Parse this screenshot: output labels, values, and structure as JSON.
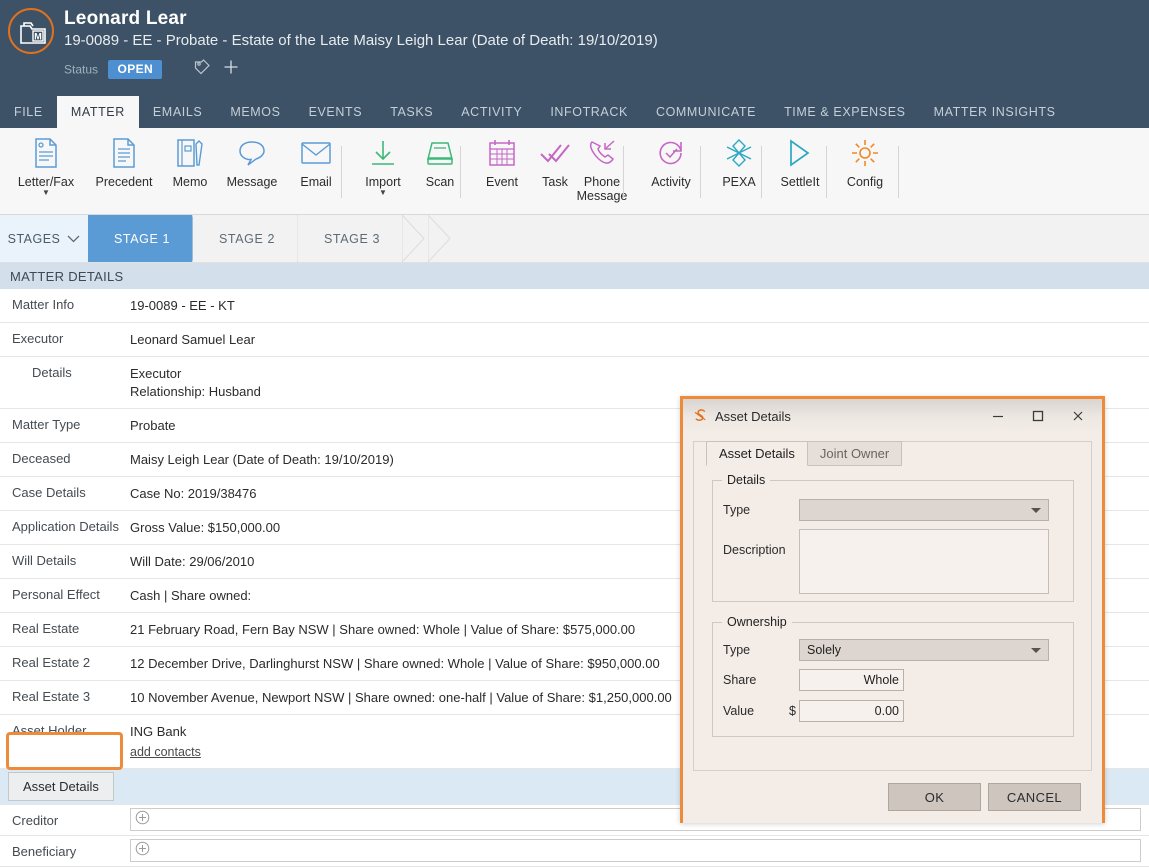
{
  "header": {
    "client_name": "Leonard Lear",
    "matter_line": "19-0089 - EE - Probate - Estate of the Late Maisy Leigh Lear (Date of Death: 19/10/2019)",
    "status_label": "Status",
    "status_value": "OPEN",
    "avatar_icon": "matter-folder-icon",
    "tag_icon": "tag-icon",
    "add_tag_icon": "plus-icon",
    "accent_color": "#e2711d",
    "background_color": "#3d5266"
  },
  "nav_tabs": [
    {
      "label": "FILE",
      "active": false
    },
    {
      "label": "MATTER",
      "active": true
    },
    {
      "label": "EMAILS",
      "active": false
    },
    {
      "label": "MEMOS",
      "active": false
    },
    {
      "label": "EVENTS",
      "active": false
    },
    {
      "label": "TASKS",
      "active": false
    },
    {
      "label": "ACTIVITY",
      "active": false
    },
    {
      "label": "INFOTRACK",
      "active": false
    },
    {
      "label": "COMMUNICATE",
      "active": false
    },
    {
      "label": "TIME & EXPENSES",
      "active": false
    },
    {
      "label": "MATTER INSIGHTS",
      "active": false
    }
  ],
  "ribbon": [
    {
      "label": "Letter/Fax",
      "icon": "document-pin-icon",
      "color": "#5b9bd5",
      "caret": true
    },
    {
      "label": "Precedent",
      "icon": "document-lines-icon",
      "color": "#5b9bd5",
      "caret": false
    },
    {
      "label": "Memo",
      "icon": "notebook-pen-icon",
      "color": "#5b9bd5",
      "caret": false
    },
    {
      "label": "Message",
      "icon": "speech-bubble-icon",
      "color": "#5b9bd5",
      "caret": false
    },
    {
      "label": "Email",
      "icon": "envelope-icon",
      "color": "#5b9bd5",
      "caret": false
    },
    {
      "label": "Import",
      "icon": "download-arrow-icon",
      "color": "#3cb878",
      "caret": true
    },
    {
      "label": "Scan",
      "icon": "scanner-icon",
      "color": "#3cb878",
      "caret": false
    },
    {
      "label": "Event",
      "icon": "calendar-icon",
      "color": "#c566c5",
      "caret": false
    },
    {
      "label": "Task",
      "icon": "double-check-icon",
      "color": "#c566c5",
      "caret": false
    },
    {
      "label": "Phone\nMessage",
      "icon": "phone-incoming-icon",
      "color": "#c566c5",
      "caret": false
    },
    {
      "label": "Activity",
      "icon": "clock-check-icon",
      "color": "#c566c5",
      "caret": false
    },
    {
      "label": "PEXA",
      "icon": "pexa-star-icon",
      "color": "#2aa8c4",
      "caret": false
    },
    {
      "label": "SettleIt",
      "icon": "arrow-flag-icon",
      "color": "#2aa8c4",
      "caret": false
    },
    {
      "label": "Config",
      "icon": "gear-icon",
      "color": "#f08a24",
      "caret": false
    }
  ],
  "stages": {
    "dropdown_label": "STAGES",
    "items": [
      {
        "label": "STAGE 1",
        "active": true
      },
      {
        "label": "STAGE 2",
        "active": false
      },
      {
        "label": "STAGE 3",
        "active": false
      }
    ]
  },
  "section_title": "MATTER DETAILS",
  "detail_rows": [
    {
      "label": "Matter Info",
      "value": "19-0089 - EE - KT"
    },
    {
      "label": "Executor",
      "value": "Leonard Samuel Lear"
    },
    {
      "label": "Details",
      "value": "Executor\nRelationship: Husband",
      "indent": true,
      "tall": true
    },
    {
      "label": "Matter Type",
      "value": "Probate"
    },
    {
      "label": "Deceased",
      "value": "Maisy Leigh Lear (Date of Death: 19/10/2019)"
    },
    {
      "label": "Case Details",
      "value": "Case No: 2019/38476"
    },
    {
      "label": "Application Details",
      "value": "Gross Value: $150,000.00"
    },
    {
      "label": "Will Details",
      "value": "Will Date: 29/06/2010"
    },
    {
      "label": "Personal Effect",
      "value": "Cash | Share owned:"
    },
    {
      "label": "Real Estate",
      "value": "21 February Road, Fern Bay NSW | Share owned: Whole | Value of Share: $575,000.00"
    },
    {
      "label": "Real Estate 2",
      "value": "12 December Drive, Darlinghurst NSW | Share owned: Whole | Value of Share: $950,000.00"
    },
    {
      "label": "Real Estate 3",
      "value": "10 November Avenue, Newport NSW | Share owned: one-half | Value of Share: $1,250,000.00"
    },
    {
      "label": "Asset Holder",
      "value": "ING Bank",
      "link": "add contacts",
      "tall": true
    }
  ],
  "asset_details_row": {
    "button_label": "Asset Details",
    "highlight_color": "#dbe9f5",
    "annotation_color": "#ed8b3a"
  },
  "plus_rows": [
    {
      "label": "Creditor",
      "icon": "circle-plus-icon"
    },
    {
      "label": "Beneficiary",
      "icon": "circle-plus-icon"
    }
  ],
  "dialog": {
    "title": "Asset Details",
    "logo_icon": "smokeball-s-icon",
    "window_buttons": [
      {
        "name": "minimize",
        "glyph": "minimize-icon"
      },
      {
        "name": "maximize",
        "glyph": "maximize-icon"
      },
      {
        "name": "close",
        "glyph": "close-icon"
      }
    ],
    "tabs": [
      {
        "label": "Asset Details",
        "active": true
      },
      {
        "label": "Joint Owner",
        "active": false
      }
    ],
    "details_group": {
      "title": "Details",
      "type_label": "Type",
      "type_value": "",
      "description_label": "Description",
      "description_value": ""
    },
    "ownership_group": {
      "title": "Ownership",
      "type_label": "Type",
      "type_value": "Solely",
      "share_label": "Share",
      "share_value": "Whole",
      "value_label": "Value",
      "currency_symbol": "$",
      "value_amount": "0.00"
    },
    "buttons": [
      {
        "label": "OK",
        "name": "ok-button"
      },
      {
        "label": "CANCEL",
        "name": "cancel-button"
      }
    ],
    "border_color": "#ed8b3a"
  }
}
